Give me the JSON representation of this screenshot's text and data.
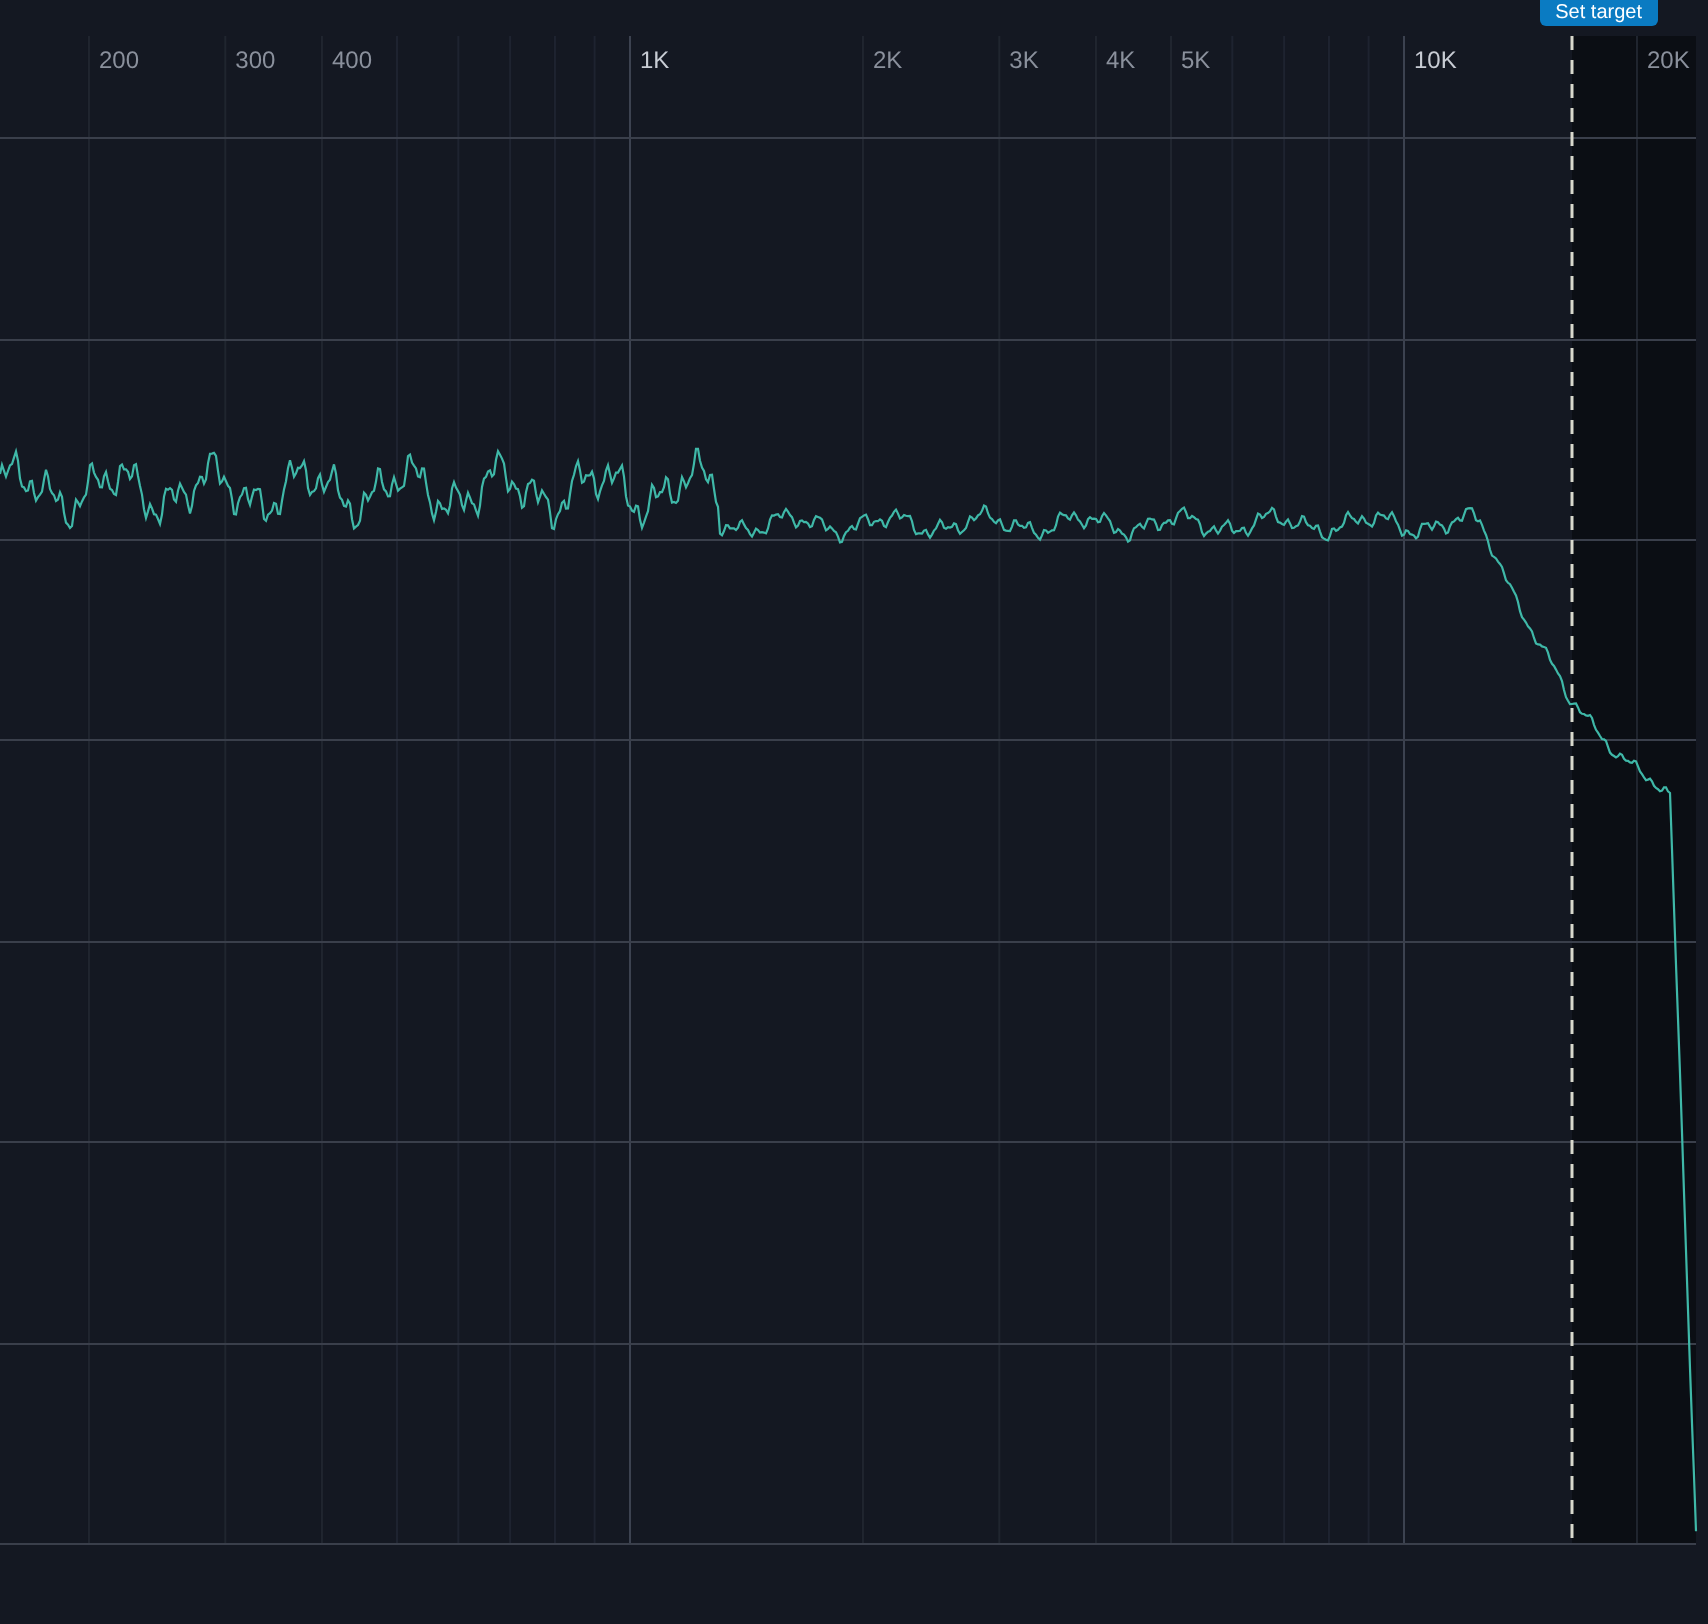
{
  "header": {
    "button": "Set target"
  },
  "chart": {
    "x_ticks": [
      {
        "label": "200"
      },
      {
        "label": "300"
      },
      {
        "label": "400"
      },
      {
        "label": "1K"
      },
      {
        "label": "2K"
      },
      {
        "label": "3K"
      },
      {
        "label": "4K"
      },
      {
        "label": "5K"
      },
      {
        "label": "10K"
      },
      {
        "label": "20K"
      }
    ]
  }
}
